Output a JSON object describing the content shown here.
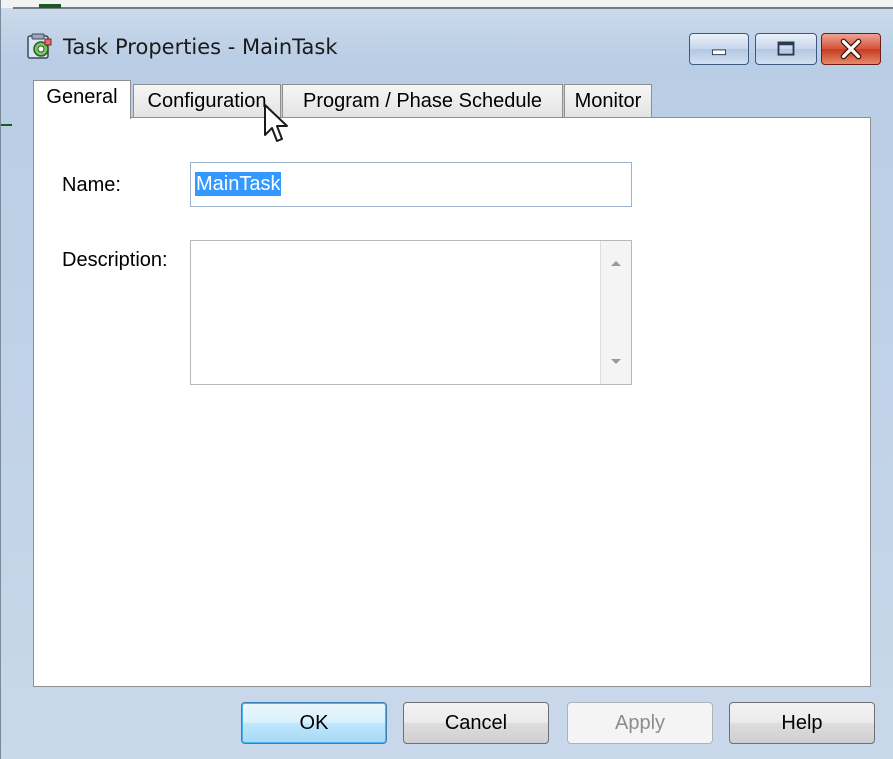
{
  "window": {
    "title": "Task Properties - MainTask"
  },
  "tabs": [
    {
      "label": "General",
      "active": true
    },
    {
      "label": "Configuration",
      "active": false
    },
    {
      "label": "Program / Phase Schedule",
      "active": false
    },
    {
      "label": "Monitor",
      "active": false
    }
  ],
  "general": {
    "name_label": "Name:",
    "name_value": "MainTask",
    "description_label": "Description:",
    "description_value": ""
  },
  "buttons": {
    "ok": "OK",
    "cancel": "Cancel",
    "apply": "Apply",
    "help": "Help"
  },
  "colors": {
    "selection": "#3399ff",
    "close_button": "#c63a20",
    "titlebar": "#b9cde5"
  }
}
